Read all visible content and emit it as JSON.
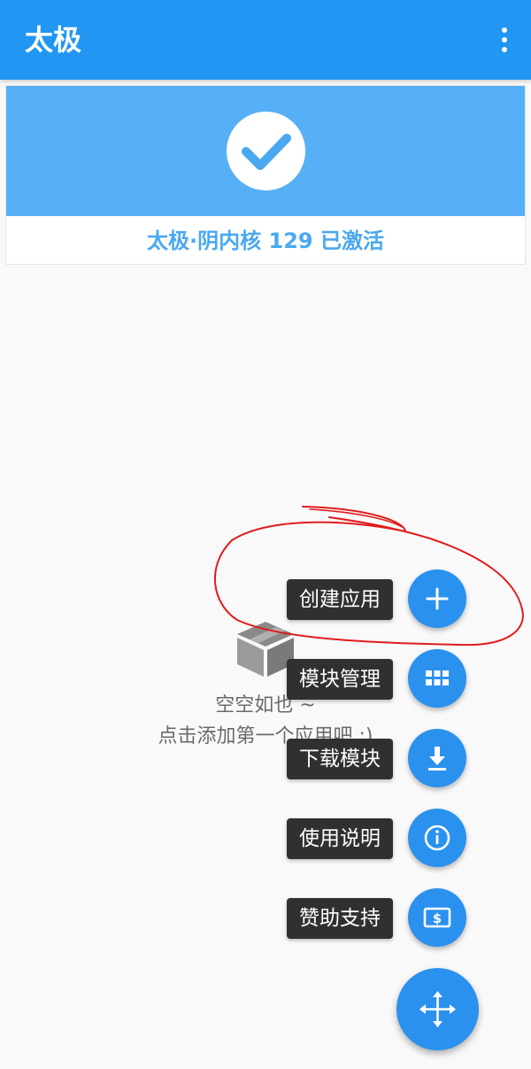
{
  "app_bar": {
    "title": "太极",
    "menu_icon": "more-vert-icon"
  },
  "status_card": {
    "icon": "check-icon",
    "text": "太极·阴内核 129 已激活",
    "colors": {
      "banner": "#57b0f6",
      "check": "#4aa8f0",
      "text": "#4aa8f0"
    }
  },
  "empty_state": {
    "icon": "package-box-icon",
    "title": "空空如也 ~",
    "subtitle": "点击添加第一个应用吧 :)"
  },
  "fab_menu": {
    "items": [
      {
        "label": "创建应用",
        "icon": "plus-icon"
      },
      {
        "label": "模块管理",
        "icon": "grid-icon"
      },
      {
        "label": "下载模块",
        "icon": "download-icon"
      },
      {
        "label": "使用说明",
        "icon": "info-icon"
      },
      {
        "label": "赞助支持",
        "icon": "donate-icon"
      }
    ],
    "main_icon": "move-arrows-icon",
    "accent_color": "#2a91ee"
  },
  "annotation": {
    "color": "#e01b1b",
    "encircles": "创建应用"
  }
}
